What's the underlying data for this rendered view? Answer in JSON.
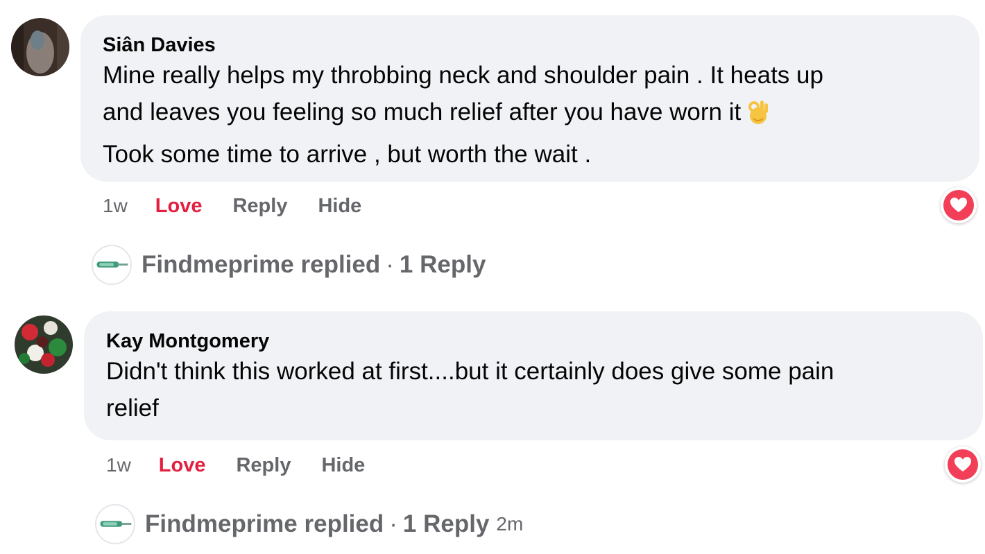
{
  "comments": [
    {
      "author": "Siân Davies",
      "lines": [
        "Mine really helps my throbbing neck and shoulder pain . It heats up",
        "and leaves you feeling so much relief after you have worn it",
        "Took some time to arrive , but worth the wait ."
      ],
      "emoji_icon": "ok-hand-emoji",
      "time": "1w",
      "love_label": "Love",
      "reply_label": "Reply",
      "hide_label": "Hide",
      "reaction_icon": "heart-reaction-icon",
      "reply_summary": {
        "page_name_text": "Findmeprime replied",
        "separator": "·",
        "count_text": "1 Reply",
        "age": ""
      }
    },
    {
      "author": "Kay Montgomery",
      "lines": [
        "Didn't think this worked at first....but it certainly does give some pain",
        "relief"
      ],
      "time": "1w",
      "love_label": "Love",
      "reply_label": "Reply",
      "hide_label": "Hide",
      "reaction_icon": "heart-reaction-icon",
      "reply_summary": {
        "page_name_text": "Findmeprime replied",
        "separator": "·",
        "count_text": "1 Reply",
        "age": "2m"
      }
    }
  ],
  "colors": {
    "bubble": "#f0f2f5",
    "love": "#e41e3f",
    "secondary_text": "#65676b",
    "primary_text": "#050505"
  }
}
